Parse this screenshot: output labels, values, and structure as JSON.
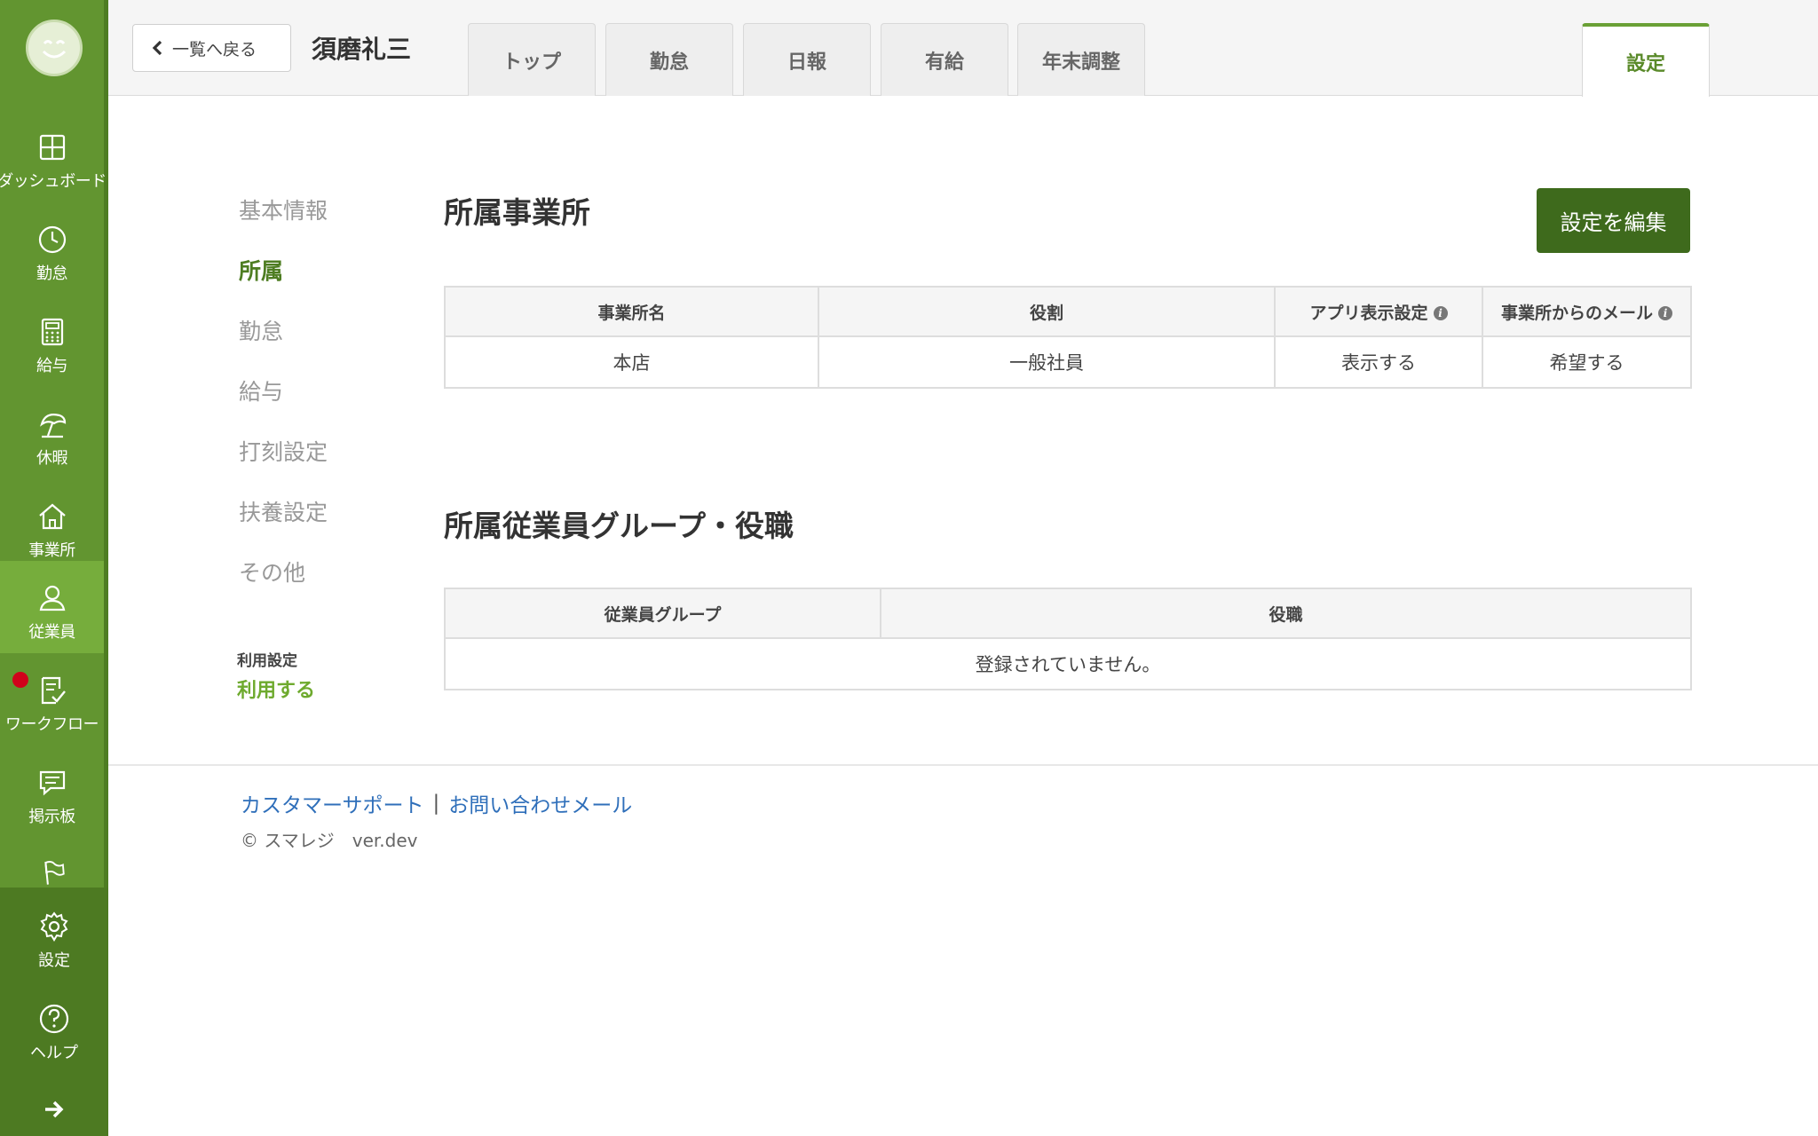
{
  "sidebar": {
    "items": [
      {
        "label": "ダッシュボード",
        "icon": "dashboard-icon"
      },
      {
        "label": "勤怠",
        "icon": "clock-icon"
      },
      {
        "label": "給与",
        "icon": "calculator-icon"
      },
      {
        "label": "休暇",
        "icon": "umbrella-icon"
      },
      {
        "label": "事業所",
        "icon": "home-icon"
      },
      {
        "label": "従業員",
        "icon": "person-icon"
      },
      {
        "label": "ワークフロー",
        "icon": "checklist-icon"
      },
      {
        "label": "掲示板",
        "icon": "chat-icon"
      },
      {
        "label": "",
        "icon": "flag-icon"
      }
    ],
    "bottom": [
      {
        "label": "設定",
        "icon": "gear-icon"
      },
      {
        "label": "ヘルプ",
        "icon": "help-icon"
      }
    ],
    "accent": "#629530"
  },
  "header": {
    "back_label": "一覧へ戻る",
    "employee_name": "須磨礼三",
    "tabs": [
      "トップ",
      "勤怠",
      "日報",
      "有給",
      "年末調整"
    ],
    "active_tab": "設定"
  },
  "subnav": {
    "items": [
      "基本情報",
      "所属",
      "勤怠",
      "給与",
      "打刻設定",
      "扶養設定",
      "その他"
    ],
    "usage_label": "利用設定",
    "usage_value": "利用する"
  },
  "office_section": {
    "title": "所属事業所",
    "edit_label": "設定を編集",
    "columns": [
      "事業所名",
      "役割",
      "アプリ表示設定",
      "事業所からのメール"
    ],
    "rows": [
      [
        "本店",
        "一般社員",
        "表示する",
        "希望する"
      ]
    ]
  },
  "group_section": {
    "title": "所属従業員グループ・役職",
    "columns": [
      "従業員グループ",
      "役職"
    ],
    "empty_message": "登録されていません。"
  },
  "footer": {
    "support_link": "カスタマーサポート",
    "separator": "|",
    "mail_link": "お問い合わせメール",
    "copyright": "© スマレジ　ver.dev"
  }
}
